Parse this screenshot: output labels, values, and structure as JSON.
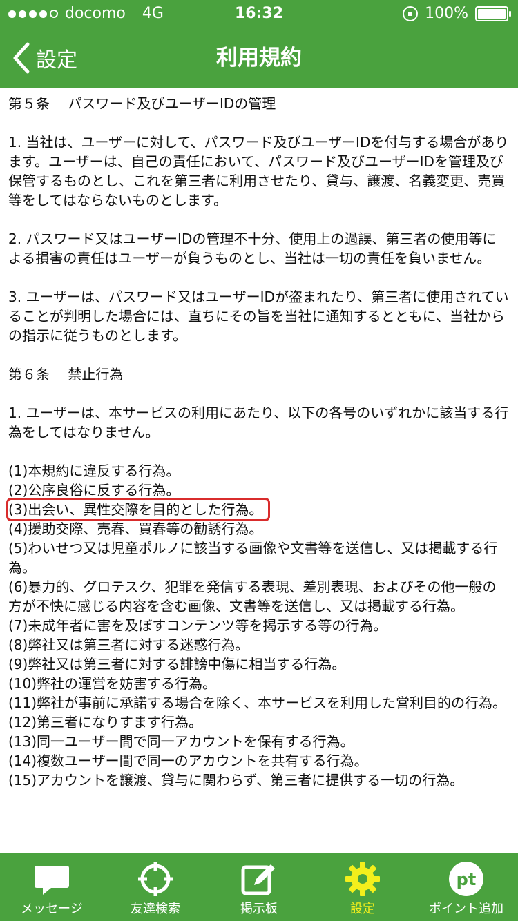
{
  "status_bar": {
    "carrier": "docomo",
    "network": "4G",
    "time": "16:32",
    "battery": "100%"
  },
  "nav": {
    "back_label": "設定",
    "title": "利用規約"
  },
  "content": {
    "sections": [
      {
        "text": "第５条　 パスワード及びユーザーIDの管理"
      },
      {
        "text": "1. 当社は、ユーザーに対して、パスワード及びユーザーIDを付与する場合があります。ユーザーは、自己の責任において、パスワード及びユーザーIDを管理及び保管するものとし、これを第三者に利用させたり、貸与、譲渡、名義変更、売買等をしてはならないものとします。"
      },
      {
        "text": "2. パスワード又はユーザーIDの管理不十分、使用上の過誤、第三者の使用等による損害の責任はユーザーが負うものとし、当社は一切の責任を負いません。"
      },
      {
        "text": "3. ユーザーは、パスワード又はユーザーIDが盗まれたり、第三者に使用されていることが判明した場合には、直ちにその旨を当社に通知するとともに、当社からの指示に従うものとします。"
      },
      {
        "text": "第６条　 禁止行為"
      },
      {
        "text": "1. ユーザーは、本サービスの利用にあたり、以下の各号のいずれかに該当する行為をしてはなりません。"
      }
    ],
    "items": [
      "(1)本規約に違反する行為。",
      "(2)公序良俗に反する行為。",
      "(3)出会い、異性交際を目的とした行為。",
      "(4)援助交際、売春、買春等の勧誘行為。",
      "(5)わいせつ又は児童ポルノに該当する画像や文書等を送信し、又は掲載する行為。",
      "(6)暴力的、グロテスク、犯罪を発信する表現、差別表現、およびその他一般の方が不快に感じる内容を含む画像、文書等を送信し、又は掲載する行為。",
      "(7)未成年者に害を及ぼすコンテンツ等を掲示する等の行為。",
      "(8)弊社又は第三者に対する迷惑行為。",
      "(9)弊社又は第三者に対する誹謗中傷に相当する行為。",
      "(10)弊社の運営を妨害する行為。",
      "(11)弊社が事前に承諾する場合を除く、本サービスを利用した営利目的の行為。",
      "(12)第三者になりすます行為。",
      "(13)同一ユーザー間で同一アカウントを保有する行為。",
      "(14)複数ユーザー間で同一のアカウントを共有する行為。",
      "(15)アカウントを譲渡、貸与に関わらず、第三者に提供する一切の行為。"
    ]
  },
  "tabs": [
    {
      "label": "メッセージ",
      "icon": "message-bubble-icon"
    },
    {
      "label": "友達検索",
      "icon": "crosshair-icon"
    },
    {
      "label": "掲示板",
      "icon": "edit-board-icon"
    },
    {
      "label": "設定",
      "icon": "gear-icon",
      "active": true
    },
    {
      "label": "ポイント追加",
      "icon": "points-pt-icon"
    }
  ],
  "colors": {
    "brand_green": "#4aa23e",
    "active_tab": "#f3ef1c",
    "highlight_box": "#d92c2c"
  }
}
